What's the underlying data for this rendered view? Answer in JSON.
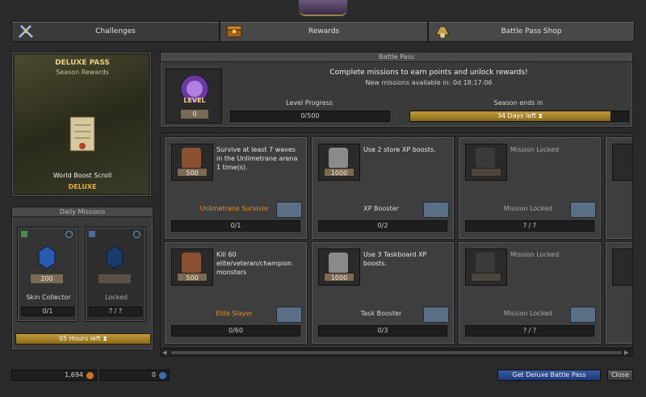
{
  "tabs": [
    {
      "label": "Challenges",
      "icon": "crossed-swords-icon",
      "active": true
    },
    {
      "label": "Rewards",
      "icon": "treasure-chest-icon",
      "active": false
    },
    {
      "label": "Battle Pass Shop",
      "icon": "shop-icon",
      "active": false
    }
  ],
  "featured": {
    "pass_name": "DELUXE PASS",
    "subtitle": "Season Rewards",
    "item_name": "World Boost Scroll",
    "item_tag": "DELUXE"
  },
  "daily": {
    "header": "Daily Missions",
    "cards": [
      {
        "points": "200",
        "name": "Skin Collector",
        "progress": "0/1"
      },
      {
        "points": "",
        "name": "Locked",
        "progress": "? / ?"
      }
    ],
    "timer": "05 Hours left"
  },
  "battle_pass": {
    "header": "Battle Pass",
    "message": "Complete missions to earn points and unlock rewards!",
    "new_missions": "New missions available in: 0d 18:17:06",
    "level_label": "LEVEL",
    "level_value": "0",
    "level_progress_label": "Level Progress",
    "level_progress_value": "0/500",
    "season_label": "Season ends in",
    "season_value": "34 Days left"
  },
  "missions": [
    {
      "points": "500",
      "desc": "Survive at least 7 waves in the Unlimetrane arena 1 time(s).",
      "title": "Unlimetrane Survivor",
      "progress": "0/1",
      "locked": false,
      "highlight": true,
      "badge": "bronze"
    },
    {
      "points": "1000",
      "desc": "Use 2 store XP boosts.",
      "title": "XP Booster",
      "progress": "0/2",
      "locked": false,
      "highlight": false,
      "badge": "silver"
    },
    {
      "points": "",
      "desc": "Mission Locked",
      "title": "Mission Locked",
      "progress": "? / ?",
      "locked": true,
      "highlight": false,
      "badge": "dark"
    },
    {
      "points": "500",
      "desc": "Kill 60 elite/veteran/champion monsters",
      "title": "Elite Slayer",
      "progress": "0/60",
      "locked": false,
      "highlight": true,
      "badge": "bronze"
    },
    {
      "points": "1000",
      "desc": "Use 3 Taskboard XP boosts.",
      "title": "Task Booster",
      "progress": "0/3",
      "locked": false,
      "highlight": false,
      "badge": "silver"
    },
    {
      "points": "",
      "desc": "Mission Locked",
      "title": "Mission Locked",
      "progress": "? / ?",
      "locked": true,
      "highlight": false,
      "badge": "dark"
    }
  ],
  "footer": {
    "gold": "1,694",
    "tokens": "0",
    "deluxe_button": "Get Deluxe Battle Pass",
    "close_button": "Close"
  },
  "colors": {
    "accent_orange": "#e8902a",
    "gold_bar": "#b08a2a",
    "button_blue": "#2a4a8a"
  }
}
